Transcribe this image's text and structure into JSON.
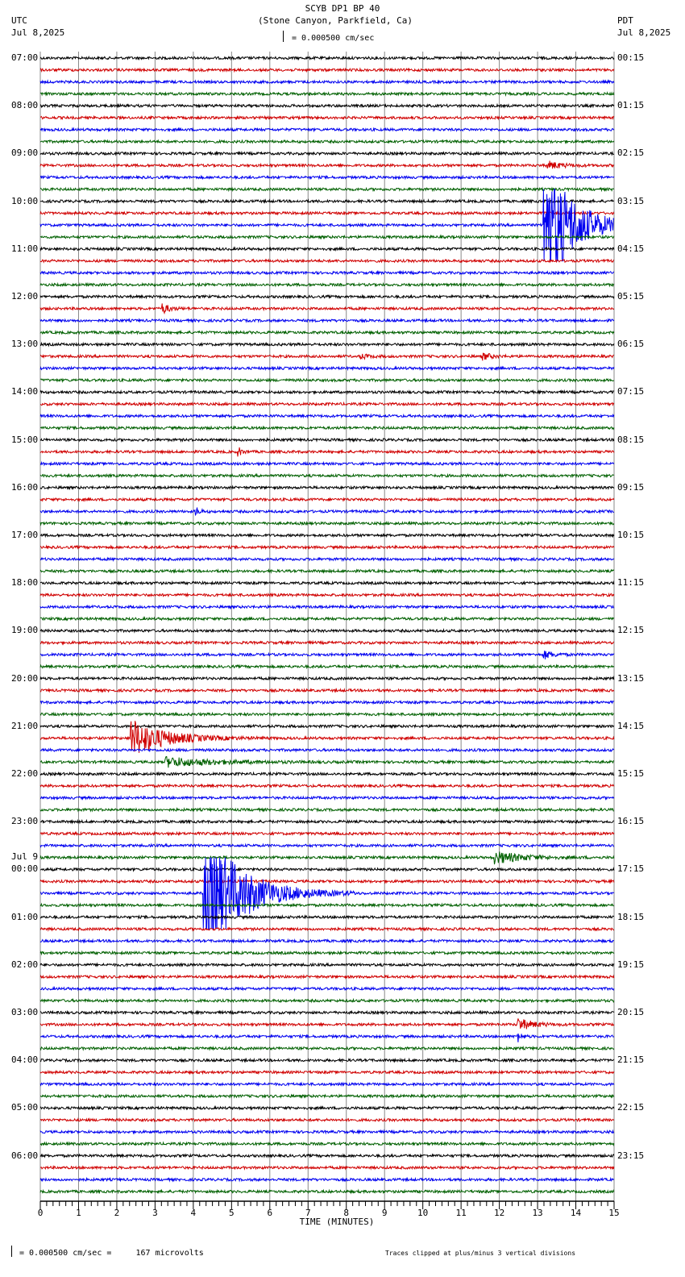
{
  "header": {
    "title": "SCYB DP1 BP 40",
    "subtitle": "(Stone Canyon, Parkfield, Ca)",
    "left_tz": "UTC",
    "left_date": "Jul 8,2025",
    "right_tz": "PDT",
    "right_date": "Jul 8,2025",
    "scale": "= 0.000500 cm/sec"
  },
  "footer": {
    "scale": "= 0.000500 cm/sec =     167 microvolts",
    "clip_note": "Traces clipped at plus/minus 3 vertical divisions"
  },
  "chart_data": {
    "type": "line",
    "title": "SCYB DP1 BP 40",
    "xlabel": "TIME (MINUTES)",
    "xlim": [
      0,
      15
    ],
    "x_ticks": [
      "0",
      "1",
      "2",
      "3",
      "4",
      "5",
      "6",
      "7",
      "8",
      "9",
      "10",
      "11",
      "12",
      "13",
      "14",
      "15"
    ],
    "traces_per_hour": 4,
    "trace_colors": [
      "#000000",
      "#d00000",
      "#0000f0",
      "#006000"
    ],
    "left_labels": [
      "07:00",
      "08:00",
      "09:00",
      "10:00",
      "11:00",
      "12:00",
      "13:00",
      "14:00",
      "15:00",
      "16:00",
      "17:00",
      "18:00",
      "19:00",
      "20:00",
      "21:00",
      "22:00",
      "23:00",
      "00:00",
      "01:00",
      "02:00",
      "03:00",
      "04:00",
      "05:00",
      "06:00"
    ],
    "date_change_label": "Jul 9",
    "right_labels": [
      "00:15",
      "01:15",
      "02:15",
      "03:15",
      "04:15",
      "05:15",
      "06:15",
      "07:15",
      "08:15",
      "09:15",
      "10:15",
      "11:15",
      "12:15",
      "13:15",
      "14:15",
      "15:15",
      "16:15",
      "17:15",
      "18:15",
      "19:15",
      "20:15",
      "21:15",
      "22:15",
      "23:15"
    ],
    "clip_divisions": 3,
    "events": [
      {
        "trace": 9,
        "minute": 13.3,
        "amp": 0.3,
        "duration": 0.8
      },
      {
        "trace": 14,
        "minute": 13.2,
        "amp": 6,
        "duration": 1.6
      },
      {
        "trace": 21,
        "minute": 3.2,
        "amp": 0.4,
        "duration": 0.4
      },
      {
        "trace": 25,
        "minute": 8.4,
        "amp": 0.2,
        "duration": 0.4
      },
      {
        "trace": 25,
        "minute": 11.6,
        "amp": 0.25,
        "duration": 0.5
      },
      {
        "trace": 33,
        "minute": 5.2,
        "amp": 0.3,
        "duration": 0.2
      },
      {
        "trace": 38,
        "minute": 4.1,
        "amp": 0.3,
        "duration": 0.2
      },
      {
        "trace": 50,
        "minute": 13.2,
        "amp": 0.3,
        "duration": 0.5
      },
      {
        "trace": 57,
        "minute": 2.4,
        "amp": 1.6,
        "duration": 1.8
      },
      {
        "trace": 59,
        "minute": 3.3,
        "amp": 0.4,
        "duration": 2.6
      },
      {
        "trace": 67,
        "minute": 11.9,
        "amp": 0.5,
        "duration": 1.5
      },
      {
        "trace": 70,
        "minute": 4.3,
        "amp": 6,
        "duration": 2.0
      },
      {
        "trace": 81,
        "minute": 12.5,
        "amp": 0.5,
        "duration": 0.8
      },
      {
        "trace": 82,
        "minute": 12.5,
        "amp": 0.4,
        "duration": 0.2
      }
    ]
  }
}
